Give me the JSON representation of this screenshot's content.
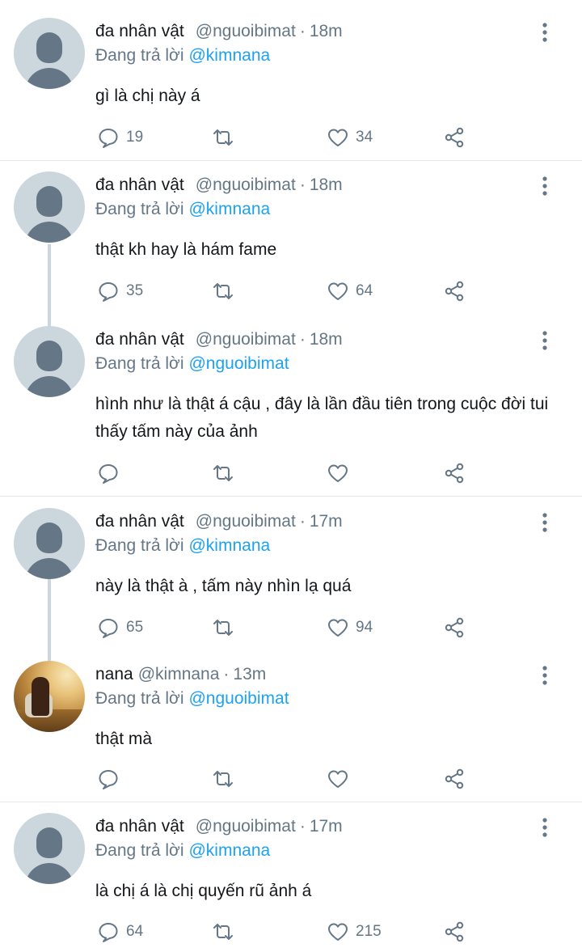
{
  "tweets": [
    {
      "name": "đa nhân vật",
      "handle": "@nguoibimat",
      "separator": "·",
      "time": "18m",
      "replying_prefix": "Đang trả lời",
      "replying_to": "@kimnana",
      "text": "gì là chị này á",
      "reply_count": "19",
      "retweet_count": "",
      "like_count": "34"
    },
    {
      "name": "đa nhân vật",
      "handle": "@nguoibimat",
      "separator": "·",
      "time": "18m",
      "replying_prefix": "Đang trả lời",
      "replying_to": "@kimnana",
      "text": "thật kh hay là hám fame",
      "reply_count": "35",
      "retweet_count": "",
      "like_count": "64"
    },
    {
      "name": "đa nhân vật",
      "handle": "@nguoibimat",
      "separator": "·",
      "time": "18m",
      "replying_prefix": "Đang trả lời",
      "replying_to": "@nguoibimat",
      "text": "hình như là thật á cậu , đây là lần đầu tiên trong cuộc đời tui thấy tấm này của ảnh",
      "reply_count": "",
      "retweet_count": "",
      "like_count": ""
    },
    {
      "name": "đa nhân vật",
      "handle": "@nguoibimat",
      "separator": "·",
      "time": "17m",
      "replying_prefix": "Đang trả lời",
      "replying_to": "@kimnana",
      "text": "này là thật à , tấm này nhìn lạ quá",
      "reply_count": "65",
      "retweet_count": "",
      "like_count": "94"
    },
    {
      "name": "nana",
      "handle": "@kimnana",
      "separator": "·",
      "time": "13m",
      "replying_prefix": "Đang trả lời",
      "replying_to": "@nguoibimat",
      "text": "thật mà",
      "reply_count": "",
      "retweet_count": "",
      "like_count": ""
    },
    {
      "name": "đa nhân vật",
      "handle": "@nguoibimat",
      "separator": "·",
      "time": "17m",
      "replying_prefix": "Đang trả lời",
      "replying_to": "@kimnana",
      "text": "là chị á là chị quyến rũ ảnh á",
      "reply_count": "64",
      "retweet_count": "",
      "like_count": "215"
    }
  ],
  "icons": {
    "reply": "speech-bubble-icon",
    "retweet": "retweet-arrows-icon",
    "like": "heart-icon",
    "share": "share-nodes-icon",
    "more": "vertical-dots-icon"
  },
  "colors": {
    "link": "#1da1f2",
    "secondary_text": "#657786",
    "avatar_placeholder": "#ccd6dd",
    "avatar_silhouette": "#657786",
    "divider": "#e1e8ed"
  }
}
